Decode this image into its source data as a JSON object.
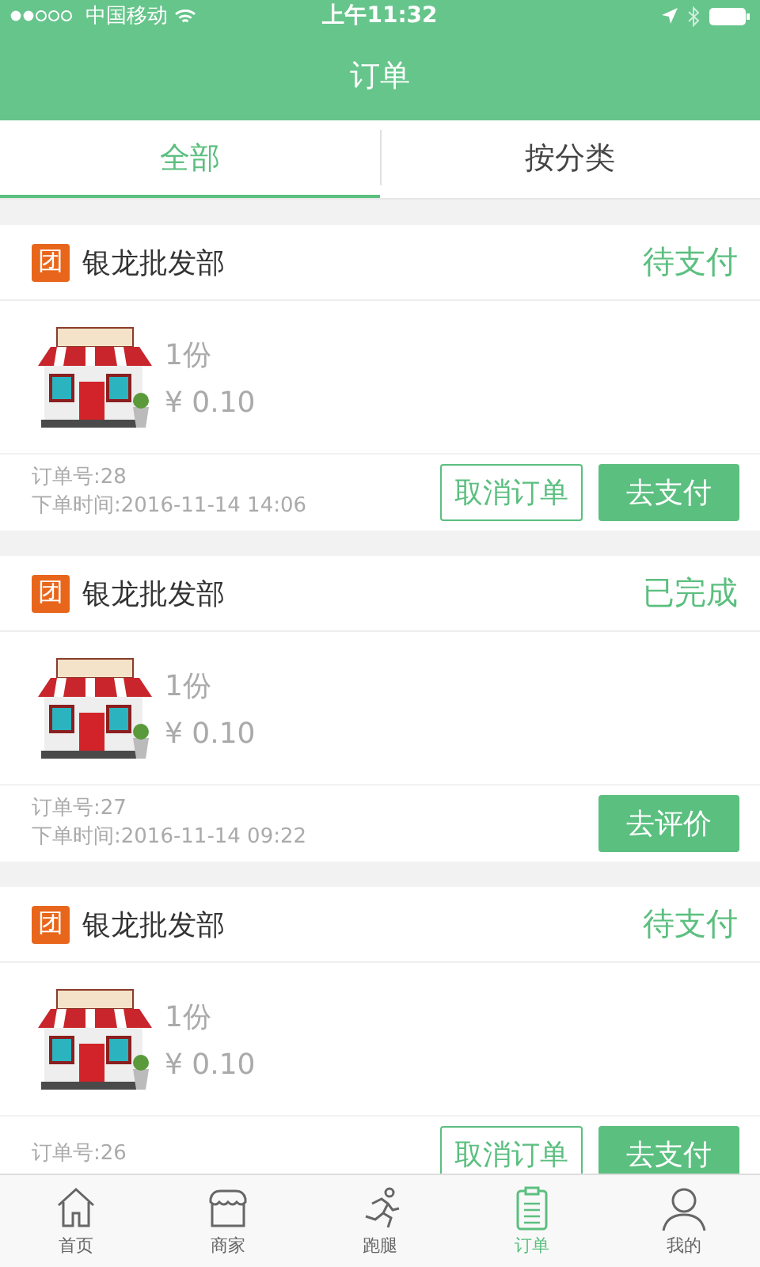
{
  "status_bar": {
    "carrier": "中国移动",
    "time": "上午11:32"
  },
  "header": {
    "title": "订单"
  },
  "tabs": [
    {
      "label": "全部",
      "selected": true
    },
    {
      "label": "按分类",
      "selected": false
    }
  ],
  "orders": [
    {
      "badge": "团",
      "shop": "银龙批发部",
      "status": "待支付",
      "quantity": "1份",
      "price": "¥ 0.10",
      "order_no": "订单号:28",
      "time": "下单时间:2016-11-14 14:06",
      "buttons": [
        {
          "label": "取消订单",
          "kind": "outline"
        },
        {
          "label": "去支付",
          "kind": "filled"
        }
      ]
    },
    {
      "badge": "团",
      "shop": "银龙批发部",
      "status": "已完成",
      "quantity": "1份",
      "price": "¥ 0.10",
      "order_no": "订单号:27",
      "time": "下单时间:2016-11-14 09:22",
      "buttons": [
        {
          "label": "去评价",
          "kind": "filled"
        }
      ]
    },
    {
      "badge": "团",
      "shop": "银龙批发部",
      "status": "待支付",
      "quantity": "1份",
      "price": "¥ 0.10",
      "order_no": "订单号:26",
      "buttons": [
        {
          "label": "取消订单",
          "kind": "outline"
        },
        {
          "label": "去支付",
          "kind": "filled"
        }
      ]
    }
  ],
  "tab_bar": [
    {
      "label": "首页",
      "kind": "home",
      "selected": false
    },
    {
      "label": "商家",
      "kind": "shop",
      "selected": false
    },
    {
      "label": "跑腿",
      "kind": "run",
      "selected": false
    },
    {
      "label": "订单",
      "kind": "clipboard",
      "selected": true
    },
    {
      "label": "我的",
      "kind": "person",
      "selected": false
    }
  ]
}
